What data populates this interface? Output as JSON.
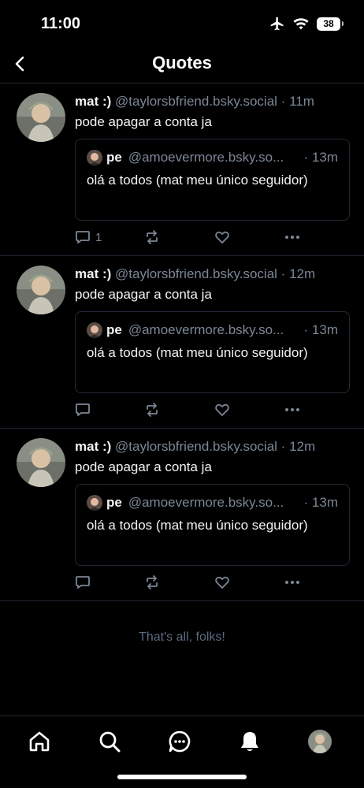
{
  "status_bar": {
    "time": "11:00",
    "battery": "38"
  },
  "header": {
    "title": "Quotes"
  },
  "posts": [
    {
      "author_name": "mat :)",
      "author_handle": "@taylorsbfriend.bsky.social",
      "time": "11m",
      "text": "pode apagar a conta ja",
      "reply_count": "1",
      "quote": {
        "author_name": "pe",
        "author_handle": "@amoevermore.bsky.so...",
        "time": "13m",
        "text": "olá a todos (mat meu único seguidor)"
      }
    },
    {
      "author_name": "mat :)",
      "author_handle": "@taylorsbfriend.bsky.social",
      "time": "12m",
      "text": "pode apagar a conta ja",
      "reply_count": "",
      "quote": {
        "author_name": "pe",
        "author_handle": "@amoevermore.bsky.so...",
        "time": "13m",
        "text": "olá a todos (mat meu único seguidor)"
      }
    },
    {
      "author_name": "mat :)",
      "author_handle": "@taylorsbfriend.bsky.social",
      "time": "12m",
      "text": "pode apagar a conta ja",
      "reply_count": "",
      "quote": {
        "author_name": "pe",
        "author_handle": "@amoevermore.bsky.so...",
        "time": "13m",
        "text": "olá a todos (mat meu único seguidor)"
      }
    }
  ],
  "end_of_feed": "That's all, folks!",
  "tab_bar": {
    "icons": [
      "home-icon",
      "search-icon",
      "chat-icon",
      "notifications-icon",
      "profile-avatar"
    ]
  },
  "colors": {
    "background": "#000000",
    "muted": "#7b8796",
    "divider": "#1e2530"
  }
}
